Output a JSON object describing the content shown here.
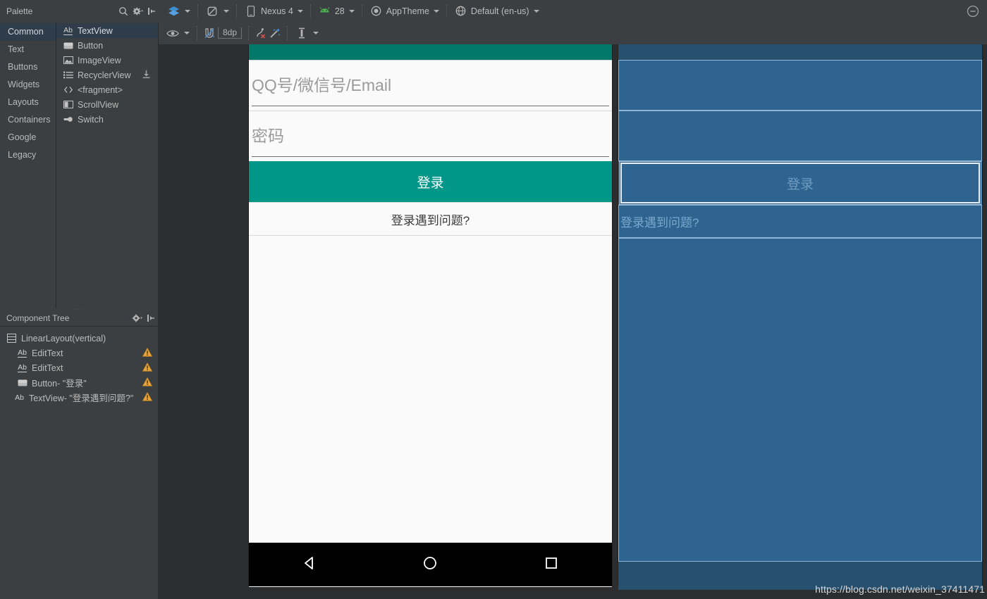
{
  "window": {
    "collapse_icon": "collapse-circle-icon"
  },
  "palette": {
    "title": "Palette",
    "search_icon": "search-icon",
    "gear_icon": "gear-icon",
    "collapse_icon": "collapse-panel-icon",
    "categories": [
      {
        "label": "Common",
        "selected": true
      },
      {
        "label": "Text",
        "selected": false
      },
      {
        "label": "Buttons",
        "selected": false
      },
      {
        "label": "Widgets",
        "selected": false
      },
      {
        "label": "Layouts",
        "selected": false
      },
      {
        "label": "Containers",
        "selected": false
      },
      {
        "label": "Google",
        "selected": false
      },
      {
        "label": "Legacy",
        "selected": false
      }
    ],
    "items": [
      {
        "label": "TextView",
        "icon": "textview-icon",
        "selected": true,
        "download": false
      },
      {
        "label": "Button",
        "icon": "button-icon",
        "selected": false,
        "download": false
      },
      {
        "label": "ImageView",
        "icon": "imageview-icon",
        "selected": false,
        "download": false
      },
      {
        "label": "RecyclerView",
        "icon": "recyclerview-icon",
        "selected": false,
        "download": true
      },
      {
        "label": "<fragment>",
        "icon": "fragment-icon",
        "selected": false,
        "download": false
      },
      {
        "label": "ScrollView",
        "icon": "scrollview-icon",
        "selected": false,
        "download": false
      },
      {
        "label": "Switch",
        "icon": "switch-icon",
        "selected": false,
        "download": false
      }
    ]
  },
  "toolbar": {
    "layers_icon": "layers-icon",
    "orientation_icon": "rotate-orientation-icon",
    "device_icon": "phone-icon",
    "device_label": "Nexus 4",
    "api_icon": "android-icon",
    "api_label": "28",
    "theme_icon": "theme-icon",
    "theme_label": "AppTheme",
    "locale_icon": "globe-icon",
    "locale_label": "Default (en-us)"
  },
  "design_toolbar": {
    "visibility_icon": "eye-icon",
    "autoconnect_icon": "autoconnect-magnet-icon",
    "margin_value": "8dp",
    "clear_constraints_icon": "clear-constraints-icon",
    "infer_constraints_icon": "infer-constraints-wand-icon",
    "guideline_icon": "baseline-guideline-icon"
  },
  "component_tree": {
    "title": "Component Tree",
    "gear_icon": "gear-icon",
    "collapse_icon": "collapse-panel-icon",
    "rows": [
      {
        "icon": "linearlayout-icon",
        "label": "LinearLayout(vertical)",
        "indent": 0,
        "warning": false
      },
      {
        "icon": "edittext-icon",
        "label": "EditText",
        "indent": 1,
        "warning": true
      },
      {
        "icon": "edittext-icon",
        "label": "EditText",
        "indent": 1,
        "warning": true
      },
      {
        "icon": "button-icon",
        "label": "Button- \"登录\"",
        "indent": 1,
        "warning": true
      },
      {
        "icon": "textview-icon",
        "label": "TextView- \"登录遇到问题?\"",
        "indent": 1,
        "warning": true
      }
    ]
  },
  "preview": {
    "username_hint": "QQ号/微信号/Email",
    "password_hint": "密码",
    "login_button": "登录",
    "problem_link": "登录遇到问题?",
    "nav_back_icon": "nav-back-icon",
    "nav_home_icon": "nav-home-icon",
    "nav_recents_icon": "nav-recents-icon",
    "accent_color": "#009688",
    "status_color": "#00796b"
  },
  "blueprint": {
    "login_button": "登录",
    "problem_link": "登录遇到问题?",
    "surface_color": "#2f6490",
    "outline_color": "#8fb6d4"
  },
  "watermark": {
    "text": "https://blog.csdn.net/weixin_37411471"
  }
}
